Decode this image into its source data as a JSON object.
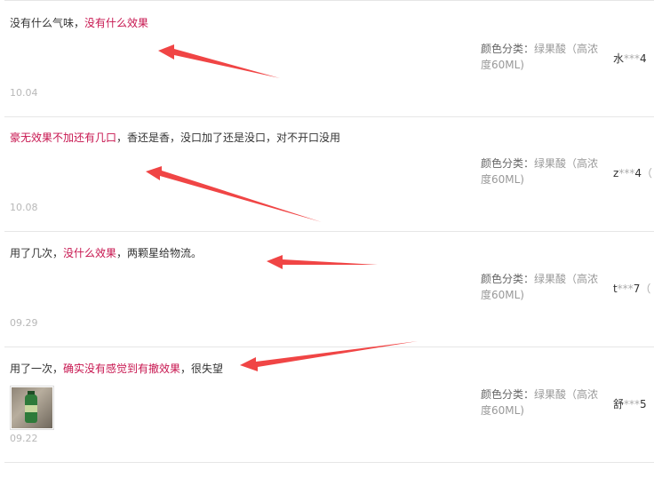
{
  "colors": {
    "highlight": "#c7154f",
    "arrow": "#f04545",
    "divider": "#e6e6e6"
  },
  "reviews": [
    {
      "segments": [
        "没有什么气味，",
        "没有什么效果"
      ],
      "date": "10.04",
      "sku_label": "颜色分类：",
      "sku_value": "绿果酸（高浓度60ML)",
      "user_name": "水",
      "user_stars": "***",
      "user_suffix": "4",
      "user_extra": "",
      "has_image": false
    },
    {
      "segments": [
        "豪无效果不加还有几口",
        "，香还是香，没口加了还是没口，对不开口没用"
      ],
      "date": "10.08",
      "sku_label": "颜色分类：",
      "sku_value": "绿果酸（高浓度60ML)",
      "user_name": "z",
      "user_stars": "***",
      "user_suffix": "4",
      "user_extra": "（",
      "has_image": false
    },
    {
      "segments": [
        "用了几次，",
        "没什么效果",
        "，两颗星给物流。"
      ],
      "date": "09.29",
      "sku_label": "颜色分类：",
      "sku_value": "绿果酸（高浓度60ML)",
      "user_name": "t",
      "user_stars": "***",
      "user_suffix": "7",
      "user_extra": "（",
      "has_image": false
    },
    {
      "segments": [
        "用了一次，",
        "确实没有感觉到有撤效果",
        "，很失望"
      ],
      "date": "09.22",
      "sku_label": "颜色分类：",
      "sku_value": "绿果酸（高浓度60ML)",
      "user_name": "舒",
      "user_stars": "***",
      "user_suffix": "5",
      "user_extra": "",
      "has_image": true
    }
  ]
}
